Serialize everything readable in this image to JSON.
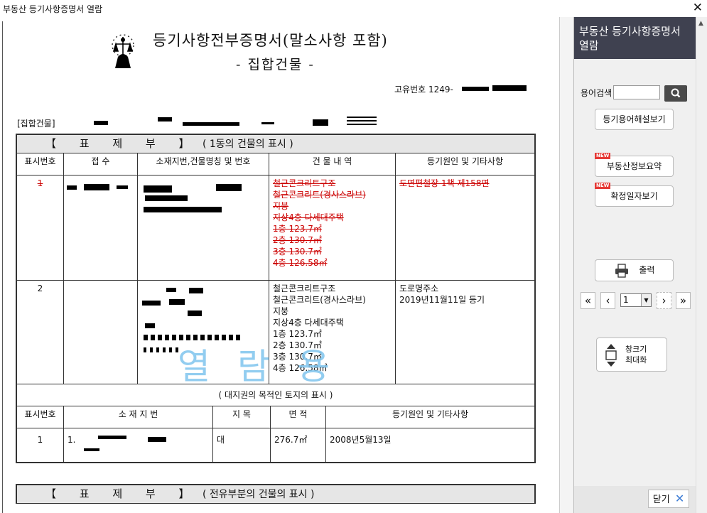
{
  "window": {
    "title": "부동산 등기사항증명서 열람",
    "close_glyph": "✕"
  },
  "document": {
    "title": "등기사항전부증명서(말소사항 포함)",
    "subtitle": "- 집합건물 -",
    "unique_no_label": "고유번호 1249-",
    "kind_label": "[집합건물]",
    "watermark": "열람용",
    "section1": {
      "title": "【 표 제 부 】",
      "subtitle": "( 1동의 건물의 표시 )"
    },
    "headers1": [
      "표시번호",
      "접 수",
      "소재지번,건물명칭 및 번호",
      "건 물 내 역",
      "등기원인 및 기타사항"
    ],
    "row1": {
      "no": "1",
      "building": [
        "철근콘크리트구조",
        "철근콘크리트(경사스라브)",
        "지붕",
        "지상4층 다세대주택",
        "1층 123.7㎡",
        "2층 130.7㎡",
        "3층 130.7㎡",
        "4층 126.58㎡"
      ],
      "cause": "도면편철장 1책 제158면"
    },
    "row2": {
      "no": "2",
      "building": [
        "철근콘크리트구조",
        "철근콘크리트(경사스라브)",
        "지붕",
        "지상4층 다세대주택",
        "1층 123.7㎡",
        "2층 130.7㎡",
        "3층 130.7㎡",
        "4층 126.58㎡"
      ],
      "cause": [
        "도로명주소",
        "2019년11월11일 등기"
      ]
    },
    "land_section_title": "( 대지권의 목적인 토지의 표시 )",
    "headers2": [
      "표시번호",
      "소 재 지 번",
      "지 목",
      "면 적",
      "등기원인 및 기타사항"
    ],
    "land_row": {
      "no": "1",
      "addr_prefix": "1.",
      "category": "대",
      "area": "276.7㎡",
      "cause": "2008년5월13일"
    },
    "section2": {
      "title": "【 표 제 부 】",
      "subtitle": "( 전유부분의 건물의 표시 )"
    }
  },
  "panel": {
    "header": "부동산 등기사항증명서 열람",
    "search_label": "용어검색",
    "search_value": "",
    "glossary_button": "등기용어해설보기",
    "summary_button": "부동산정보요약",
    "confirm_date_button": "확정일자보기",
    "new_badge": "NEW",
    "print_button": "출력",
    "page_value": "1",
    "maximize_button": [
      "창크기",
      "최대화"
    ],
    "close_button": "닫기"
  },
  "icons": {
    "search": "search-icon",
    "print": "printer-icon",
    "first": "double-chevron-left-icon",
    "prev": "chevron-left-icon",
    "next": "chevron-right-icon",
    "last": "double-chevron-right-icon",
    "resize": "resize-vertical-icon",
    "close": "close-icon"
  }
}
